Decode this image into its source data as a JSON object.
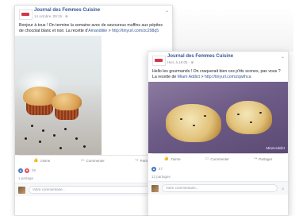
{
  "post1": {
    "page_name": "Journal des Femmes Cuisine",
    "date": "14 octobre, 09:15 · ",
    "text_a": "Bonjour à tous ! On termine la semaine avec de savoureux muffins aux pépites de chocolat blanc et noir. La recette d'",
    "author": "Amandiiiie",
    "text_b": " > ",
    "link": "http://tinyurl.com/zc298q5",
    "actions": {
      "like": "J'aime",
      "comment": "Commenter",
      "share": "Partager"
    },
    "reaction_count": "26",
    "shares": "1 partage",
    "comment_placeholder": "Votre commentaire..."
  },
  "post2": {
    "page_name": "Journal des Femmes Cuisine",
    "date": "Hier, à 19:05 · ",
    "text_a": "Hello les gourmands ! On craquerait bien ces p'tits scones, pas vous ? La recette de ",
    "author": "Miam Addict",
    "text_b": " > ",
    "link": "http://tinyurl.com/zqwthca",
    "image_watermark": "MiamAddict",
    "actions": {
      "like": "J'aime",
      "comment": "Commenter",
      "share": "Partager"
    },
    "reaction_count": "47",
    "shares": "12 partages",
    "comment_placeholder": "Votre commentaire..."
  },
  "icons": [
    "globe-icon",
    "chevron-down-icon",
    "like-icon",
    "comment-icon",
    "share-icon",
    "love-icon",
    "camera-icon",
    "emoji-icon"
  ],
  "colors": {
    "link": "#365899",
    "brand": "#d0374b",
    "like": "#4a76c9",
    "love": "#e8516a"
  }
}
